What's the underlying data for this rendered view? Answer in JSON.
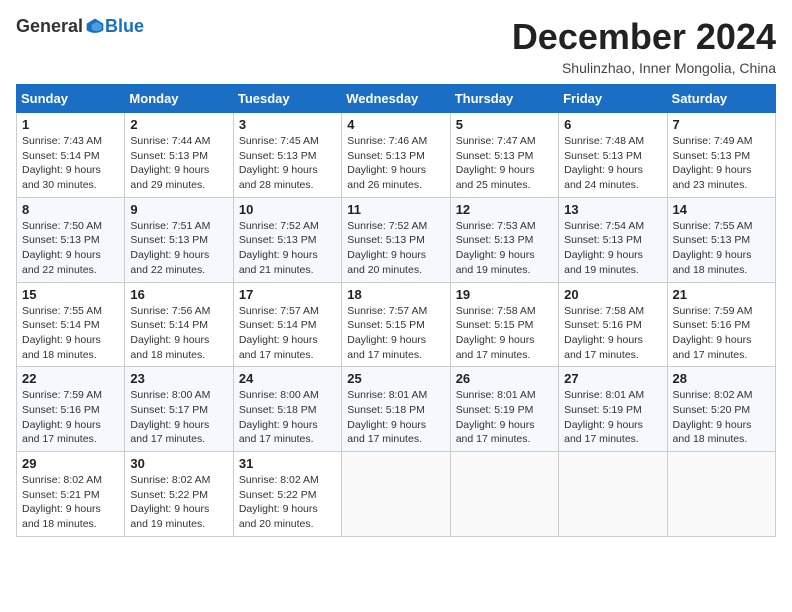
{
  "header": {
    "logo": {
      "general": "General",
      "blue": "Blue"
    },
    "title": "December 2024",
    "location": "Shulinzhao, Inner Mongolia, China"
  },
  "calendar": {
    "headers": [
      "Sunday",
      "Monday",
      "Tuesday",
      "Wednesday",
      "Thursday",
      "Friday",
      "Saturday"
    ],
    "weeks": [
      [
        null,
        null,
        null,
        null,
        null,
        null,
        null
      ]
    ],
    "days": {
      "1": {
        "rise": "7:43 AM",
        "set": "5:14 PM",
        "daylight": "9 hours and 30 minutes."
      },
      "2": {
        "rise": "7:44 AM",
        "set": "5:13 PM",
        "daylight": "9 hours and 29 minutes."
      },
      "3": {
        "rise": "7:45 AM",
        "set": "5:13 PM",
        "daylight": "9 hours and 28 minutes."
      },
      "4": {
        "rise": "7:46 AM",
        "set": "5:13 PM",
        "daylight": "9 hours and 26 minutes."
      },
      "5": {
        "rise": "7:47 AM",
        "set": "5:13 PM",
        "daylight": "9 hours and 25 minutes."
      },
      "6": {
        "rise": "7:48 AM",
        "set": "5:13 PM",
        "daylight": "9 hours and 24 minutes."
      },
      "7": {
        "rise": "7:49 AM",
        "set": "5:13 PM",
        "daylight": "9 hours and 23 minutes."
      },
      "8": {
        "rise": "7:50 AM",
        "set": "5:13 PM",
        "daylight": "9 hours and 22 minutes."
      },
      "9": {
        "rise": "7:51 AM",
        "set": "5:13 PM",
        "daylight": "9 hours and 22 minutes."
      },
      "10": {
        "rise": "7:52 AM",
        "set": "5:13 PM",
        "daylight": "9 hours and 21 minutes."
      },
      "11": {
        "rise": "7:52 AM",
        "set": "5:13 PM",
        "daylight": "9 hours and 20 minutes."
      },
      "12": {
        "rise": "7:53 AM",
        "set": "5:13 PM",
        "daylight": "9 hours and 19 minutes."
      },
      "13": {
        "rise": "7:54 AM",
        "set": "5:13 PM",
        "daylight": "9 hours and 19 minutes."
      },
      "14": {
        "rise": "7:55 AM",
        "set": "5:13 PM",
        "daylight": "9 hours and 18 minutes."
      },
      "15": {
        "rise": "7:55 AM",
        "set": "5:14 PM",
        "daylight": "9 hours and 18 minutes."
      },
      "16": {
        "rise": "7:56 AM",
        "set": "5:14 PM",
        "daylight": "9 hours and 18 minutes."
      },
      "17": {
        "rise": "7:57 AM",
        "set": "5:14 PM",
        "daylight": "9 hours and 17 minutes."
      },
      "18": {
        "rise": "7:57 AM",
        "set": "5:15 PM",
        "daylight": "9 hours and 17 minutes."
      },
      "19": {
        "rise": "7:58 AM",
        "set": "5:15 PM",
        "daylight": "9 hours and 17 minutes."
      },
      "20": {
        "rise": "7:58 AM",
        "set": "5:16 PM",
        "daylight": "9 hours and 17 minutes."
      },
      "21": {
        "rise": "7:59 AM",
        "set": "5:16 PM",
        "daylight": "9 hours and 17 minutes."
      },
      "22": {
        "rise": "7:59 AM",
        "set": "5:16 PM",
        "daylight": "9 hours and 17 minutes."
      },
      "23": {
        "rise": "8:00 AM",
        "set": "5:17 PM",
        "daylight": "9 hours and 17 minutes."
      },
      "24": {
        "rise": "8:00 AM",
        "set": "5:18 PM",
        "daylight": "9 hours and 17 minutes."
      },
      "25": {
        "rise": "8:01 AM",
        "set": "5:18 PM",
        "daylight": "9 hours and 17 minutes."
      },
      "26": {
        "rise": "8:01 AM",
        "set": "5:19 PM",
        "daylight": "9 hours and 17 minutes."
      },
      "27": {
        "rise": "8:01 AM",
        "set": "5:19 PM",
        "daylight": "9 hours and 17 minutes."
      },
      "28": {
        "rise": "8:02 AM",
        "set": "5:20 PM",
        "daylight": "9 hours and 18 minutes."
      },
      "29": {
        "rise": "8:02 AM",
        "set": "5:21 PM",
        "daylight": "9 hours and 18 minutes."
      },
      "30": {
        "rise": "8:02 AM",
        "set": "5:22 PM",
        "daylight": "9 hours and 19 minutes."
      },
      "31": {
        "rise": "8:02 AM",
        "set": "5:22 PM",
        "daylight": "9 hours and 20 minutes."
      }
    }
  }
}
